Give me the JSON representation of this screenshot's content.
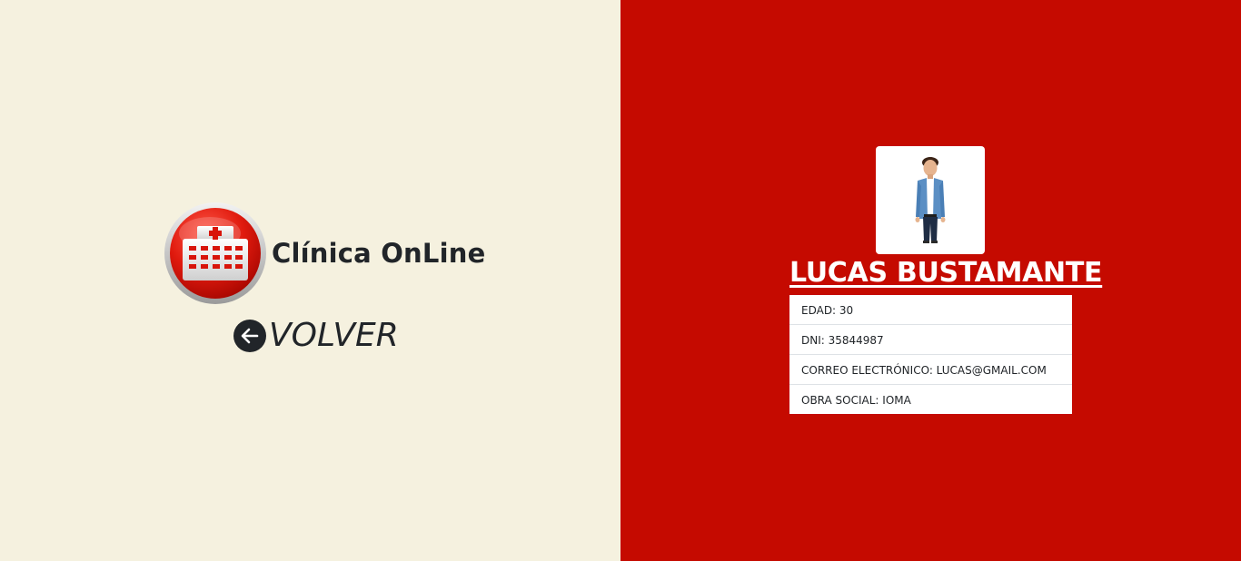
{
  "brand": {
    "name": "Clínica OnLine",
    "logo_icon": "hospital-icon"
  },
  "nav": {
    "back_label": "VOLVER",
    "back_icon": "arrow-left-circle-icon"
  },
  "profile": {
    "name": "LUCAS BUSTAMANTE",
    "avatar_icon": "user-avatar-icon",
    "details": [
      "EDAD: 30",
      "DNI: 35844987",
      "CORREO ELECTRÓNICO: LUCAS@GMAIL.COM",
      "OBRA SOCIAL: IOMA"
    ]
  },
  "colors": {
    "left_background": "#f5f1df",
    "right_background": "#c50a00",
    "text_dark": "#212529",
    "text_light": "#ffffff"
  }
}
